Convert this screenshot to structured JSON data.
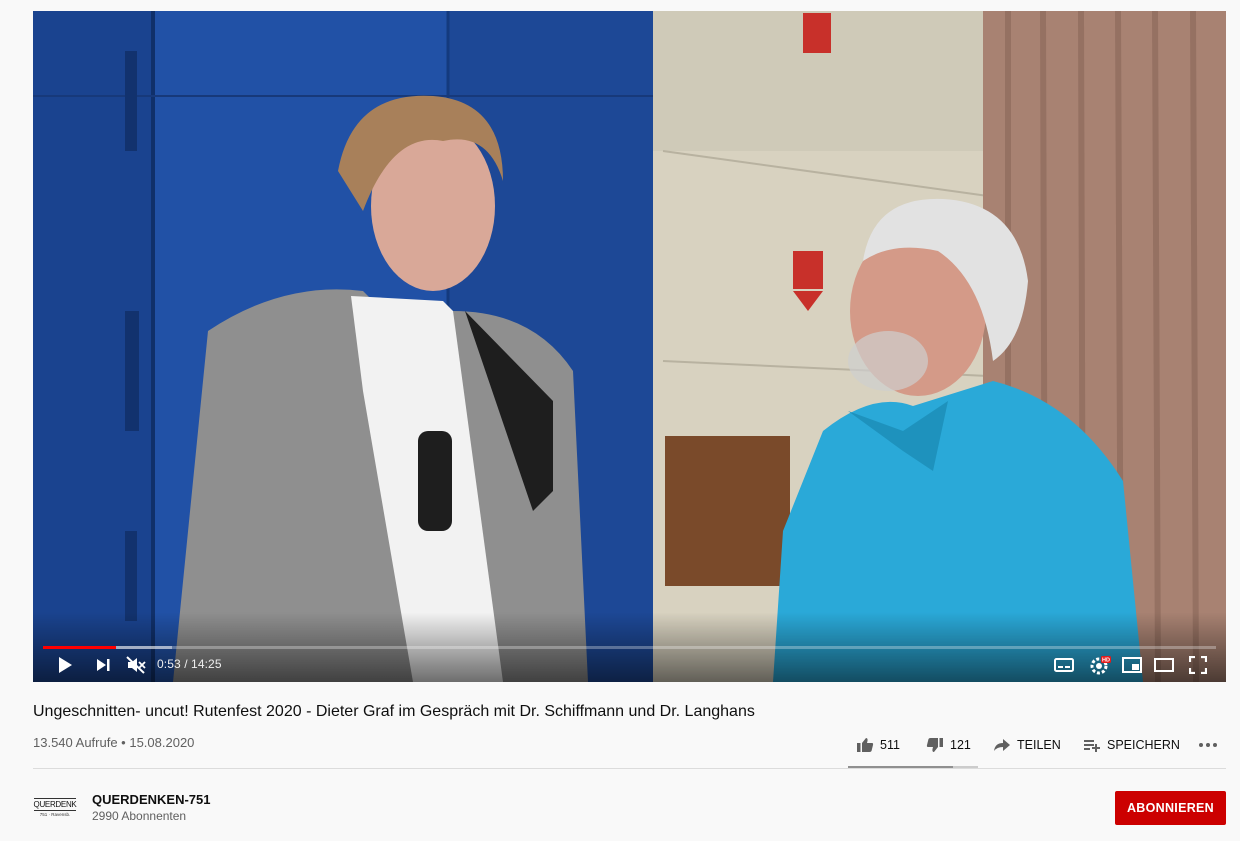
{
  "player": {
    "time_display": "0:53 / 14:25",
    "progress_played": 0.062,
    "progress_loaded": 0.11,
    "hd_badge": "HD"
  },
  "video": {
    "title": "Ungeschnitten- uncut! Rutenfest 2020 - Dieter Graf im Gespräch mit Dr. Schiffmann und Dr. Langhans",
    "meta": "13.540 Aufrufe • 15.08.2020",
    "like_count": "511",
    "dislike_count": "121",
    "share_label": "TEILEN",
    "save_label": "SPEICHERN",
    "like_ratio": 0.81
  },
  "channel": {
    "name": "QUERDENKEN-751",
    "subscribers": "2990 Abonnenten",
    "logo_text": "QUERDENK",
    "logo_subtext": "751 · Ravensb.",
    "subscribe_label": "ABONNIEREN"
  },
  "colors": {
    "accent_red": "#ff0000",
    "subscribe_bg": "#cc0000"
  }
}
